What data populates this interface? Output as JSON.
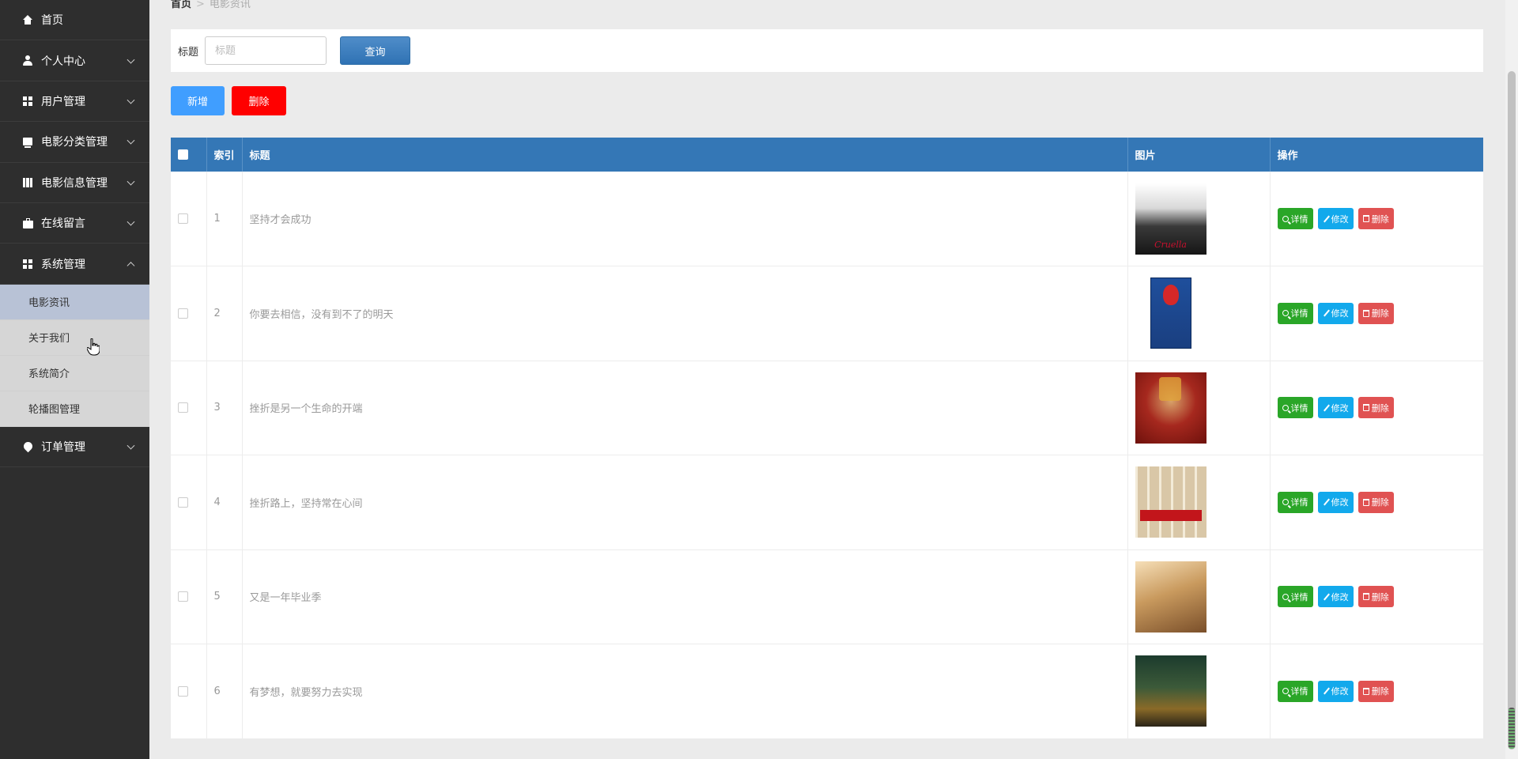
{
  "sidebar": {
    "items": [
      {
        "label": "首页",
        "icon": "home-icon"
      },
      {
        "label": "个人中心",
        "icon": "user-icon"
      },
      {
        "label": "用户管理",
        "icon": "grid-icon"
      },
      {
        "label": "电影分类管理",
        "icon": "box-icon"
      },
      {
        "label": "电影信息管理",
        "icon": "book-icon"
      },
      {
        "label": "在线留言",
        "icon": "briefcase-icon"
      },
      {
        "label": "系统管理",
        "icon": "grid-icon"
      },
      {
        "label": "订单管理",
        "icon": "pin-icon"
      }
    ],
    "submenu": [
      {
        "label": "电影资讯",
        "active": true
      },
      {
        "label": "关于我们"
      },
      {
        "label": "系统简介"
      },
      {
        "label": "轮播图管理"
      }
    ]
  },
  "breadcrumb": {
    "home": "首页",
    "current": "电影资讯"
  },
  "search": {
    "label": "标题",
    "placeholder": "标题",
    "value": "",
    "query_label": "查询"
  },
  "toolbar": {
    "add_label": "新增",
    "delete_label": "删除"
  },
  "table": {
    "headers": {
      "index": "索引",
      "title": "标题",
      "image": "图片",
      "ops": "操作"
    },
    "ops": {
      "detail": "详情",
      "edit": "修改",
      "remove": "删除"
    },
    "rows": [
      {
        "index": "1",
        "title": "坚持才会成功"
      },
      {
        "index": "2",
        "title": "你要去相信，没有到不了的明天"
      },
      {
        "index": "3",
        "title": "挫折是另一个生命的开端"
      },
      {
        "index": "4",
        "title": "挫折路上，坚持常在心间"
      },
      {
        "index": "5",
        "title": "又是一年毕业季"
      },
      {
        "index": "6",
        "title": "有梦想，就要努力去实现"
      }
    ]
  },
  "colors": {
    "sidebar_bg": "#2e2e2e",
    "table_header": "#3477b6",
    "add_button": "#409eff",
    "delete_button": "#ff0000",
    "detail_button": "#2aa628",
    "edit_button": "#12a9ec",
    "remove_button": "#e05252"
  }
}
